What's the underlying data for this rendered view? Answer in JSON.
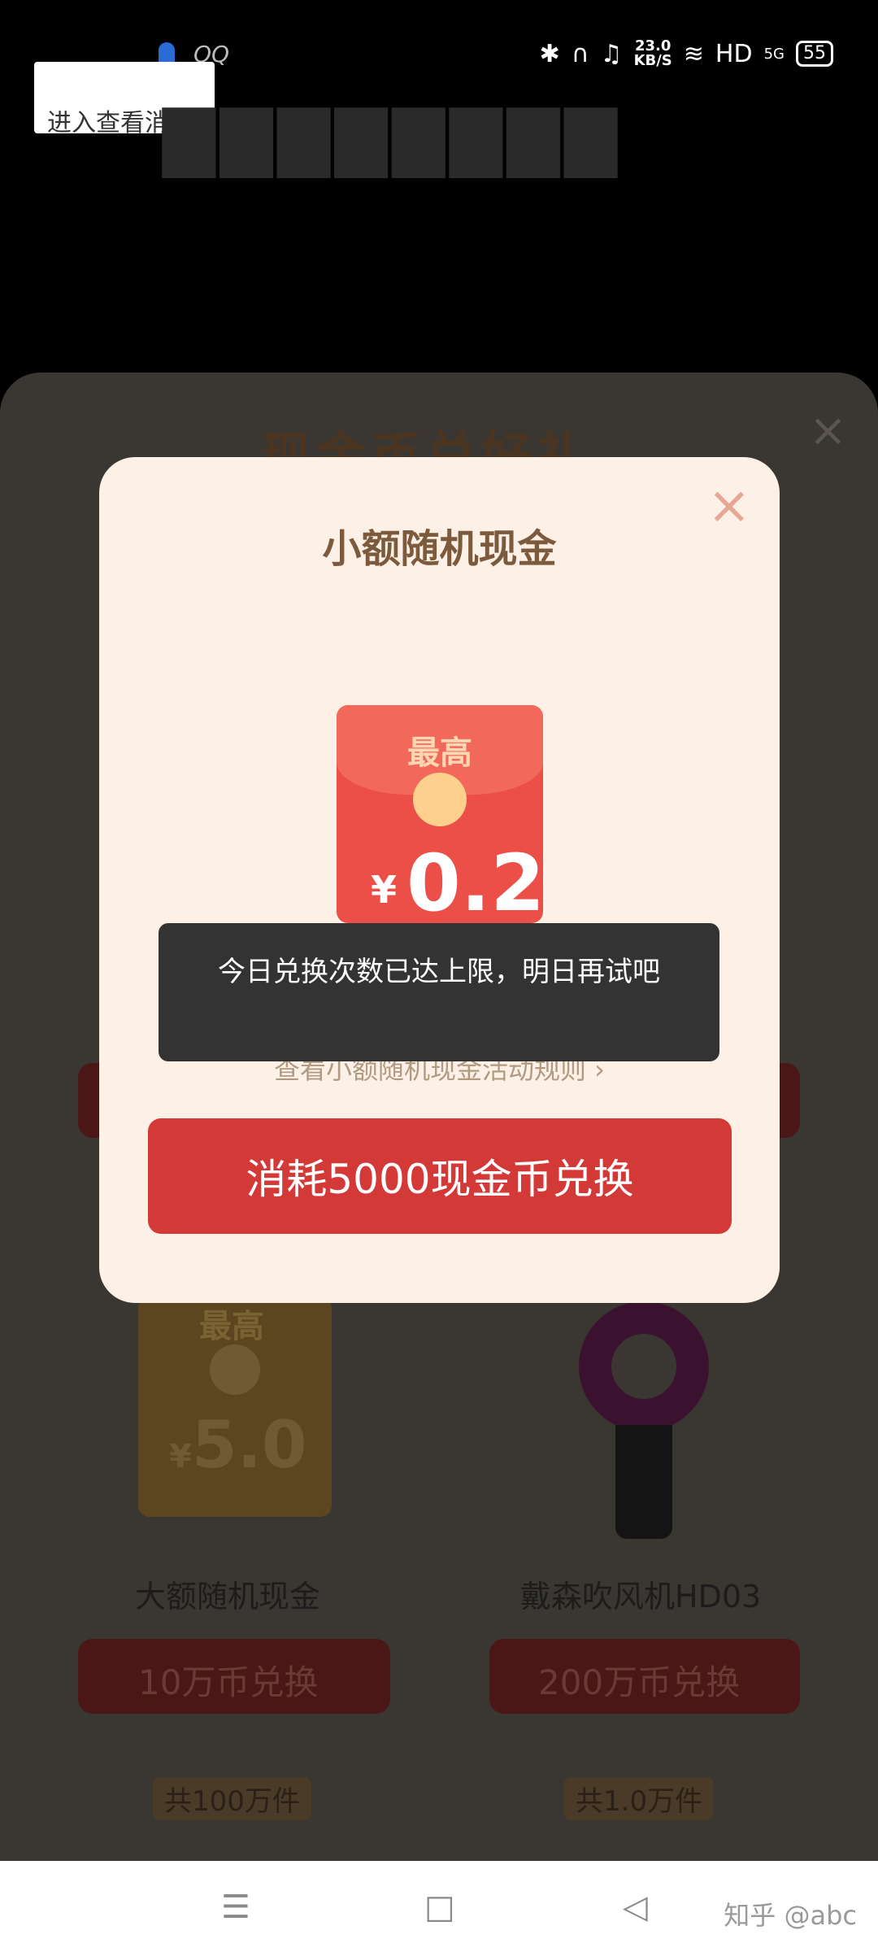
{
  "status_bar": {
    "left_text": "QQ",
    "net_speed_value": "23.0",
    "net_speed_unit": "KB/S",
    "hd": "HD",
    "signal": "5G",
    "battery": "55"
  },
  "notification": {
    "text": "进入查看消息"
  },
  "background": {
    "panel_title": "现金币兑好礼",
    "close_icon": "×",
    "items": [
      {
        "badge_top": "最高",
        "currency": "¥",
        "value": "5.0",
        "name": "大额随机现金",
        "button": "10万币兑换",
        "stock": "共100万件"
      },
      {
        "name": "戴森吹风机HD03",
        "button": "200万币兑换",
        "stock": "共1.0万件"
      }
    ]
  },
  "modal": {
    "title": "小额随机现金",
    "close_icon": "×",
    "envelope": {
      "top_label": "最高",
      "currency": "¥",
      "value": "0.2"
    },
    "rules_link": "查看小额随机现金活动规则 ›",
    "cta": "消耗5000现金币兑换"
  },
  "toast": {
    "text": "今日兑换次数已达上限，明日再试吧"
  },
  "nav": {
    "menu_icon": "☰",
    "home_icon": "□",
    "back_icon": "◁"
  },
  "watermark": "知乎 @abc"
}
